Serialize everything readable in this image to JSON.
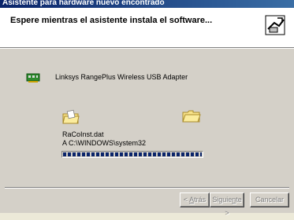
{
  "window": {
    "title": "Asistente para hardware nuevo encontrado"
  },
  "header": {
    "text": "Espere mientras el asistente instala el software...",
    "icon": "hardware-wizard-icon"
  },
  "device": {
    "name": "Linksys RangePlus Wireless USB Adapter",
    "icon": "network-adapter-icon"
  },
  "copy": {
    "file": "RaCoInst.dat",
    "destination": "A C:\\WINDOWS\\system32",
    "progress": 1.0
  },
  "buttons": {
    "back": {
      "pre": "< ",
      "accel": "A",
      "post": "trás"
    },
    "next": {
      "pre": "Siguie",
      "accel": "n",
      "post": "te >"
    },
    "cancel": "Cancelar"
  },
  "colors": {
    "titlebar": "#0a246a",
    "progress": "#0a246a",
    "face": "#d4d0c8"
  }
}
